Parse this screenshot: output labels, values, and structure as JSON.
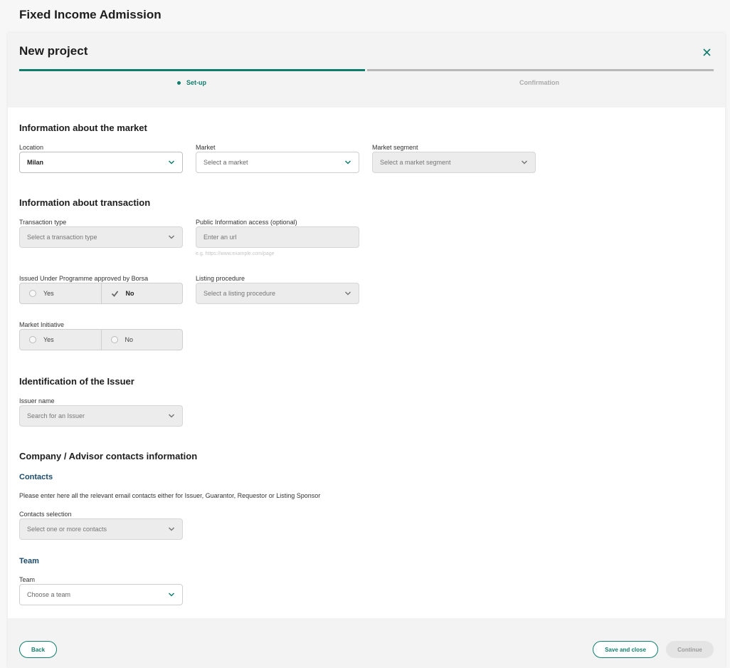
{
  "app": {
    "title": "Fixed Income Admission"
  },
  "modal": {
    "title": "New project",
    "close_icon": "close-icon",
    "steps": [
      {
        "label": "Set-up",
        "state": "active"
      },
      {
        "label": "Confirmation",
        "state": "inactive"
      }
    ]
  },
  "market_section": {
    "title": "Information about the market",
    "location": {
      "label": "Location",
      "value": "Milan"
    },
    "market": {
      "label": "Market",
      "placeholder": "Select a market"
    },
    "segment": {
      "label": "Market segment",
      "placeholder": "Select a market segment"
    }
  },
  "transaction_section": {
    "title": "Information about transaction",
    "transaction_type": {
      "label": "Transaction type",
      "placeholder": "Select a transaction type"
    },
    "public_info": {
      "label": "Public Information access (optional)",
      "placeholder": "Enter an url",
      "hint": "e.g. https://www.example.com/page"
    },
    "programme": {
      "label": "Issued Under Programme approved by Borsa",
      "yes": "Yes",
      "no": "No",
      "selected": "No"
    },
    "listing_procedure": {
      "label": "Listing procedure",
      "placeholder": "Select a listing procedure"
    },
    "market_initiative": {
      "label": "Market Initiative",
      "yes": "Yes",
      "no": "No",
      "selected": ""
    }
  },
  "issuer_section": {
    "title": "Identification of the Issuer",
    "issuer_name": {
      "label": "Issuer name",
      "placeholder": "Search for an Issuer"
    }
  },
  "contacts_section": {
    "title": "Company / Advisor contacts information",
    "contacts_subtitle": "Contacts",
    "contacts_desc": "Please enter here all the relevant email contacts either for Issuer, Guarantor, Requestor or Listing Sponsor",
    "contacts_selection": {
      "label": "Contacts selection",
      "placeholder": "Select one or more contacts"
    },
    "team_subtitle": "Team",
    "team": {
      "label": "Team",
      "placeholder": "Choose a team"
    }
  },
  "footer": {
    "back_label": "Back",
    "save_close_label": "Save and close",
    "continue_label": "Continue"
  },
  "colors": {
    "accent": "#0f7d6c",
    "subtitle": "#1b4a6b",
    "inactive": "#b8b8b8"
  }
}
